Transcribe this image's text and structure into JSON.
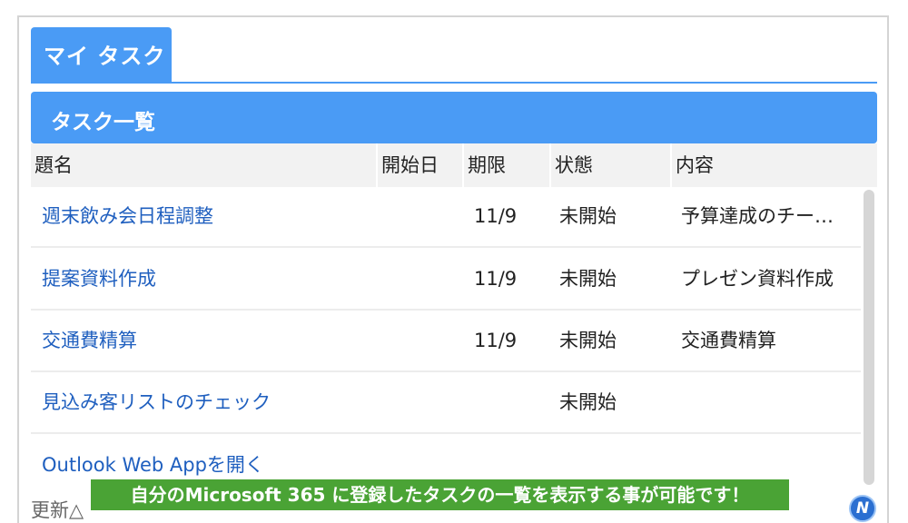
{
  "tab": {
    "label": "マイ タスク"
  },
  "panel": {
    "title": "タスク一覧"
  },
  "columns": {
    "title": "題名",
    "start": "開始日",
    "due": "期限",
    "status": "状態",
    "content": "内容"
  },
  "rows": [
    {
      "title": "週末飲み会日程調整",
      "start": "",
      "due": "11/9",
      "status": "未開始",
      "content": "予算達成のチー…"
    },
    {
      "title": "提案資料作成",
      "start": "",
      "due": "11/9",
      "status": "未開始",
      "content": "プレゼン資料作成"
    },
    {
      "title": "交通費精算",
      "start": "",
      "due": "11/9",
      "status": "未開始",
      "content": "交通費精算"
    },
    {
      "title": "見込み客リストのチェック",
      "start": "",
      "due": "",
      "status": "未開始",
      "content": ""
    }
  ],
  "link": {
    "label": "Outlook Web Appを開く"
  },
  "footer": {
    "text": "更新△"
  },
  "caption": {
    "text": "自分のMicrosoft 365 に登録したタスクの一覧を表示する事が可能です！"
  },
  "logo": {
    "text": "N"
  },
  "colors": {
    "accent": "#4a9bf5",
    "link": "#1f5fbf",
    "caption_bg": "#4aa335"
  }
}
